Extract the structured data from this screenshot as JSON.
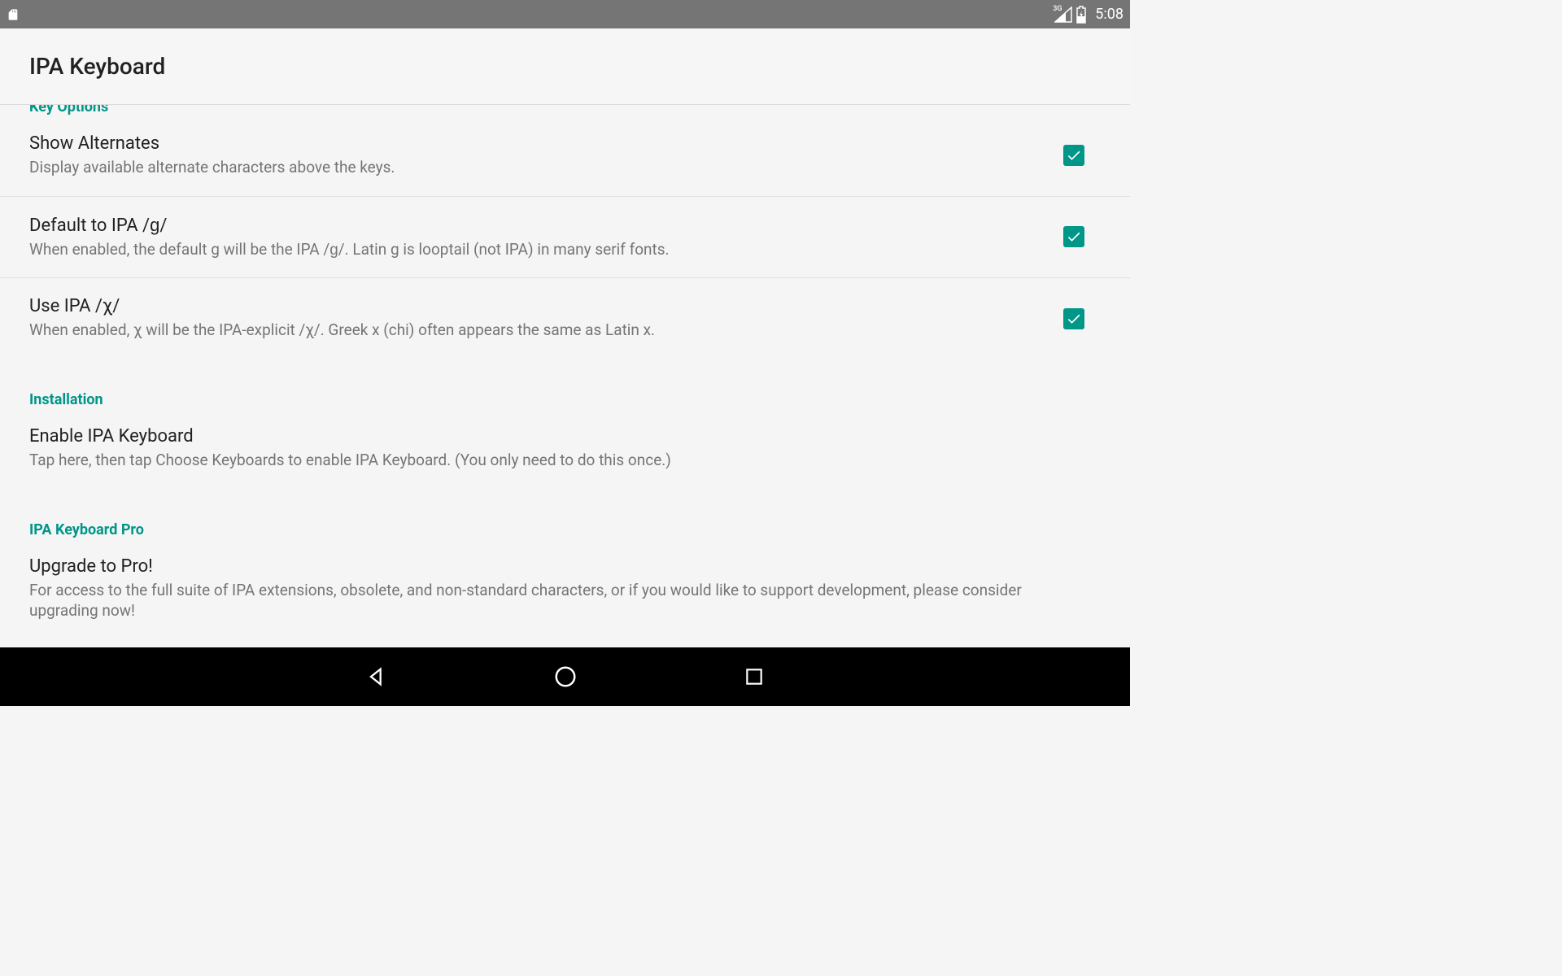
{
  "status": {
    "network": "3G",
    "time": "5:08"
  },
  "appbar": {
    "title": "IPA Keyboard"
  },
  "sections": {
    "key_options": {
      "header": "Key Options",
      "items": {
        "show_alternates": {
          "title": "Show Alternates",
          "subtitle": "Display available alternate characters above the keys.",
          "checked": true
        },
        "default_g": {
          "title": "Default to IPA /ɡ/",
          "subtitle": "When enabled, the default g will be the IPA /ɡ/. Latin g is looptail (not IPA) in many serif fonts.",
          "checked": true
        },
        "use_chi": {
          "title": "Use IPA /χ/",
          "subtitle": "When enabled, χ will be the IPA-explicit /χ/. Greek x (chi) often appears the same as Latin x.",
          "checked": true
        }
      }
    },
    "installation": {
      "header": "Installation",
      "items": {
        "enable": {
          "title": "Enable IPA Keyboard",
          "subtitle": "Tap here, then tap Choose Keyboards to enable IPA Keyboard. (You only need to do this once.)"
        }
      }
    },
    "pro": {
      "header": "IPA Keyboard Pro",
      "items": {
        "upgrade": {
          "title": "Upgrade to Pro!",
          "subtitle": "For access to the full suite of IPA extensions, obsolete, and non-standard characters, or if you would like to support development, please consider upgrading now!"
        }
      }
    }
  }
}
